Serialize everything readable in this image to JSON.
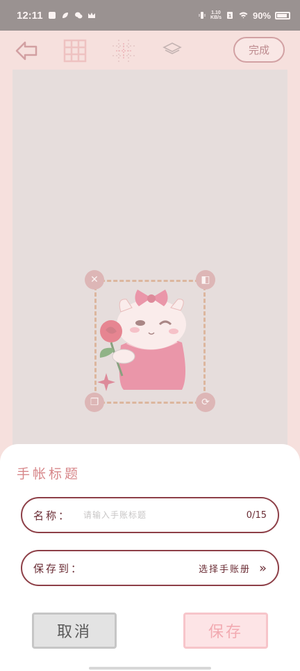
{
  "status": {
    "time": "12:11",
    "net_speed_top": "1.10",
    "net_speed_bottom": "KB/s",
    "battery": "90%"
  },
  "toolbar": {
    "done_label": "完成",
    "icons": [
      "back-arrow-icon",
      "grid-icon",
      "align-grid-icon",
      "layers-icon"
    ]
  },
  "sticker": {
    "handles": [
      "close-icon",
      "flip-icon",
      "copy-icon",
      "rotate-icon"
    ]
  },
  "sheet": {
    "title": "手帐标题",
    "name_label": "名称：",
    "name_placeholder": "请输入手账标题",
    "name_value": "",
    "name_counter": "0/15",
    "save_to_label": "保存到：",
    "save_to_value": "选择手账册",
    "cancel_label": "取消",
    "save_label": "保存"
  },
  "colors": {
    "accent": "#8d3f47",
    "title": "#d7878a",
    "save_button": "#fde4e6",
    "cancel_button": "#e3e3e3"
  }
}
